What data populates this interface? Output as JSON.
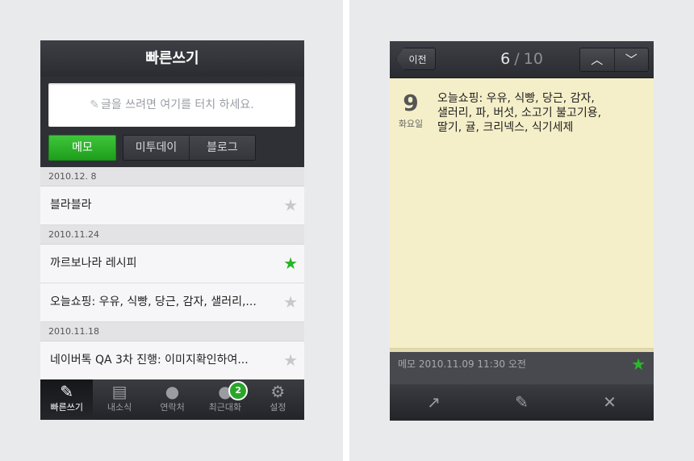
{
  "left": {
    "title": "빠른쓰기",
    "compose_placeholder": "글을 쓰려면 여기를 터치 하세요.",
    "compose_icon": "pencil-icon",
    "buttons": {
      "memo": "메모",
      "me2day": "미투데이",
      "blog": "블로그"
    },
    "groups": [
      {
        "date": "2010.12. 8",
        "items": [
          {
            "text": "블라블라",
            "starred": false
          }
        ]
      },
      {
        "date": "2010.11.24",
        "items": [
          {
            "text": "까르보나라 레시피",
            "starred": true
          },
          {
            "text": "오늘쇼핑: 우유, 식빵, 당근, 감자, 샐러리,...",
            "starred": false
          }
        ]
      },
      {
        "date": "2010.11.18",
        "items": [
          {
            "text": "네이버톡 QA 3차 진행: 이미지확인하여...",
            "starred": false
          }
        ]
      }
    ],
    "tabs": [
      {
        "label": "빠른쓰기",
        "icon": "compose-icon",
        "active": true
      },
      {
        "label": "내소식",
        "icon": "news-icon",
        "active": false
      },
      {
        "label": "연락처",
        "icon": "contacts-icon",
        "active": false
      },
      {
        "label": "최근대화",
        "icon": "chat-icon",
        "active": false,
        "badge": "2"
      },
      {
        "label": "설정",
        "icon": "gear-icon",
        "active": false
      }
    ]
  },
  "right": {
    "back_label": "이전",
    "page_current": "6",
    "page_separator": "/",
    "page_total": "10",
    "day_number": "9",
    "day_name": "화요일",
    "note_lines": [
      "오늘쇼핑: 우유, 식빵, 당근, 감자,",
      "샐러리, 파, 버섯, 소고기 불고기용,",
      "딸기, 귤, 크리넥스, 식기세제"
    ],
    "footer_meta": "메모  2010.11.09 11:30 오전",
    "footer_starred": true,
    "toolbar": [
      {
        "icon": "share-icon"
      },
      {
        "icon": "edit-icon"
      },
      {
        "icon": "delete-icon"
      }
    ]
  },
  "colors": {
    "accent_green": "#27b327",
    "dark_bar": "#2f3036",
    "note_paper": "#f5efc9"
  }
}
